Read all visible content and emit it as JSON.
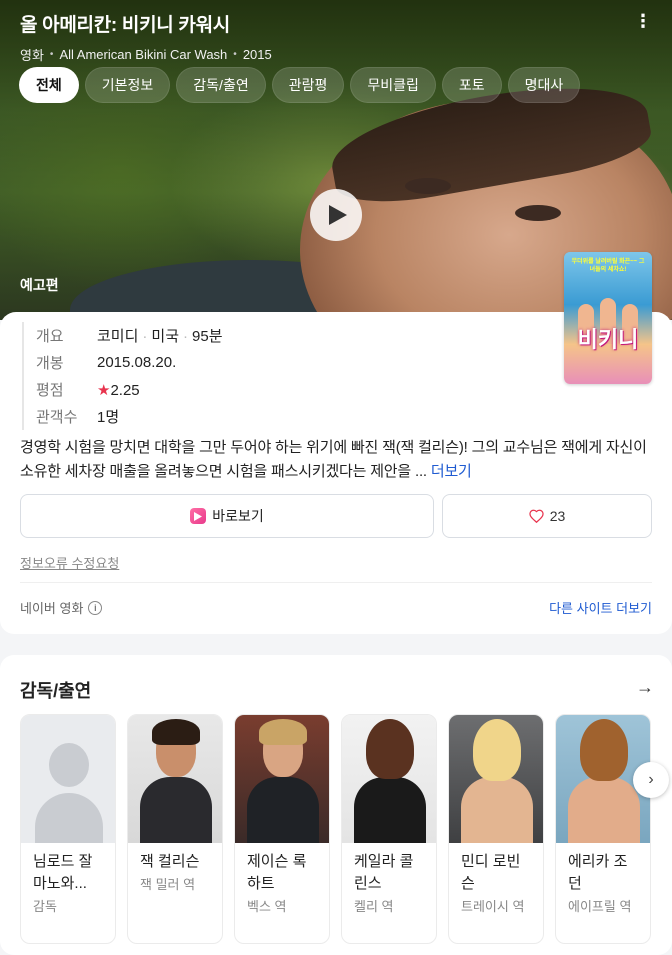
{
  "header": {
    "title": "올 아메리칸: 비키니 카워시",
    "genre": "영화",
    "original_title": "All American Bikini Car Wash",
    "year": "2015"
  },
  "tabs": [
    {
      "label": "전체",
      "active": true
    },
    {
      "label": "기본정보",
      "active": false
    },
    {
      "label": "감독/출연",
      "active": false
    },
    {
      "label": "관람평",
      "active": false
    },
    {
      "label": "무비클립",
      "active": false
    },
    {
      "label": "포토",
      "active": false
    },
    {
      "label": "명대사",
      "active": false
    }
  ],
  "hero": {
    "trailer_label": "예고편"
  },
  "facts": [
    {
      "label": "개요",
      "values": [
        "코미디",
        "미국",
        "95분"
      ]
    },
    {
      "label": "개봉",
      "values": [
        "2015.08.20."
      ]
    },
    {
      "label": "평점",
      "star": "★",
      "values": [
        "2.25"
      ]
    },
    {
      "label": "관객수",
      "values": [
        "1명"
      ]
    }
  ],
  "poster": {
    "tagline": "무더위를 날려버릴 화끈~~ 그녀들의 세차쇼!",
    "title": "비키니"
  },
  "synopsis": {
    "text": "경영학 시험을 망치면 대학을 그만 두어야 하는 위기에 빠진 잭(잭 컬리슨)! 그의 교수님은 잭에게 자신이 소유한 세차장 매출을 올려놓으면 시험을 패스시키겠다는 제안을 ... ",
    "more": "더보기"
  },
  "actions": {
    "watch_label": "바로보기",
    "like_count": "23"
  },
  "footer": {
    "report": "정보오류 수정요청",
    "source": "네이버 영화",
    "info_symbol": "i",
    "other_sites": "다른 사이트 더보기"
  },
  "cast": {
    "title": "감독/출연",
    "arrow": "→",
    "next": "›",
    "items": [
      {
        "name": "님로드 잘마노와...",
        "role": "감독"
      },
      {
        "name": "잭 컬리슨",
        "role": "잭 밀러 역"
      },
      {
        "name": "제이슨 록하트",
        "role": "벡스 역"
      },
      {
        "name": "케일라 콜린스",
        "role": "켈리 역"
      },
      {
        "name": "민디 로빈슨",
        "role": "트레이시 역"
      },
      {
        "name": "에리카 조던",
        "role": "에이프릴 역"
      }
    ]
  },
  "colors": {
    "accent_link": "#1f5bd1",
    "star": "#e8344e",
    "watch_icon": "#e83a8c"
  }
}
